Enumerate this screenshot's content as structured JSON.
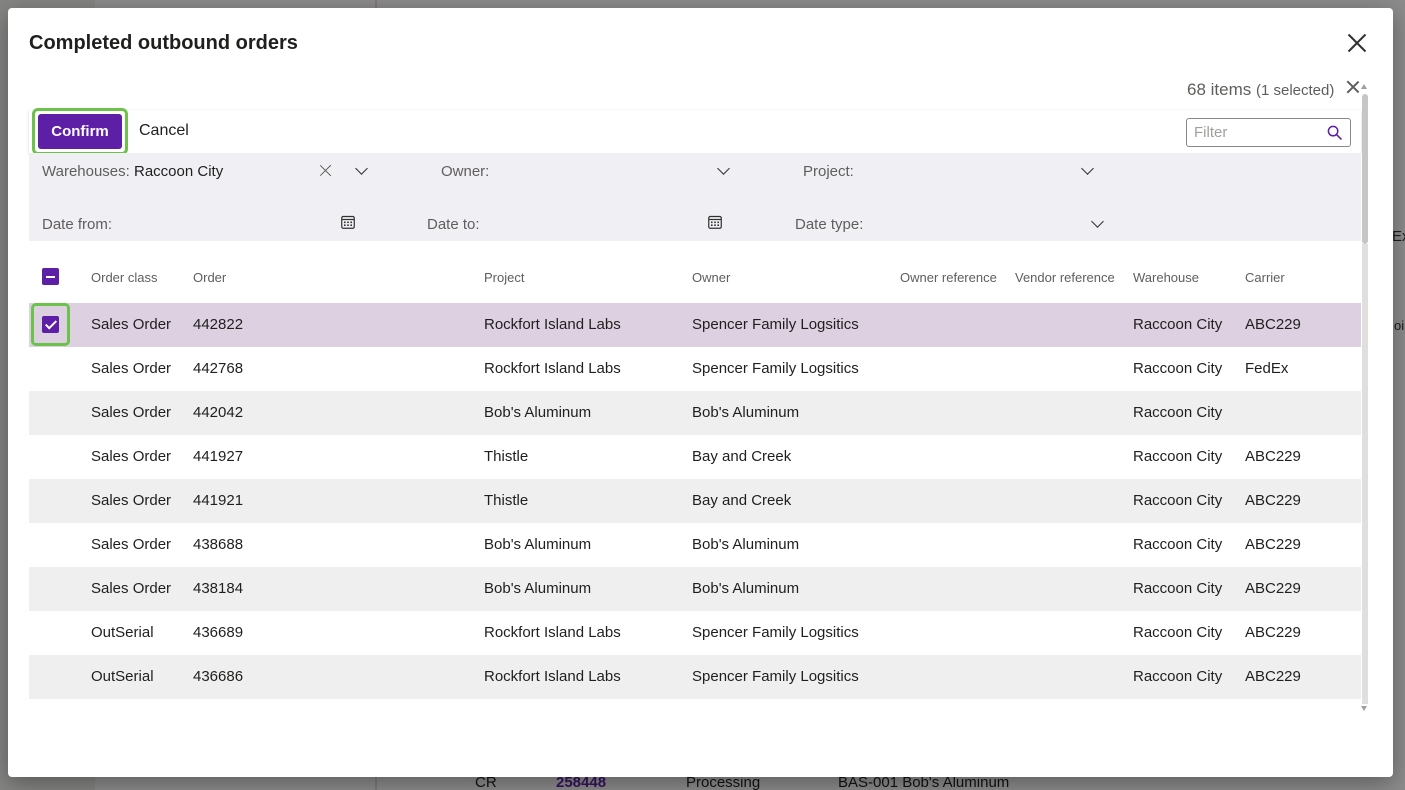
{
  "background": {
    "bottom_row": {
      "class": "CR",
      "order": "258448",
      "status": "Processing",
      "owner": "BAS-001 Bob's Aluminum"
    },
    "right_edge_top": "Ex",
    "right_edge_mid": "oi"
  },
  "dialog": {
    "title": "Completed outbound orders",
    "items_count": "68 items",
    "selected_count": "(1 selected)",
    "toolbar": {
      "confirm_label": "Confirm",
      "cancel_label": "Cancel",
      "filter_placeholder": "Filter"
    },
    "filters": {
      "warehouses_label": "Warehouses:",
      "warehouses_value": "Raccoon City",
      "owner_label": "Owner:",
      "project_label": "Project:",
      "date_from_label": "Date from:",
      "date_to_label": "Date to:",
      "date_type_label": "Date type:"
    },
    "columns": [
      "Order class",
      "Order",
      "Project",
      "Owner",
      "Owner reference",
      "Vendor reference",
      "Warehouse",
      "Carrier"
    ],
    "rows": [
      {
        "order_class": "Sales Order",
        "order": "442822",
        "project": "Rockfort Island Labs",
        "owner": "Spencer Family Logsitics",
        "owner_ref": "",
        "vendor_ref": "",
        "warehouse": "Raccoon City",
        "carrier": "ABC229",
        "selected": true
      },
      {
        "order_class": "Sales Order",
        "order": "442768",
        "project": "Rockfort Island Labs",
        "owner": "Spencer Family Logsitics",
        "owner_ref": "",
        "vendor_ref": "",
        "warehouse": "Raccoon City",
        "carrier": "FedEx",
        "selected": false
      },
      {
        "order_class": "Sales Order",
        "order": "442042",
        "project": "Bob's Aluminum",
        "owner": "Bob's Aluminum",
        "owner_ref": "",
        "vendor_ref": "",
        "warehouse": "Raccoon City",
        "carrier": "",
        "selected": false
      },
      {
        "order_class": "Sales Order",
        "order": "441927",
        "project": "Thistle",
        "owner": "Bay and Creek",
        "owner_ref": "",
        "vendor_ref": "",
        "warehouse": "Raccoon City",
        "carrier": "ABC229",
        "selected": false
      },
      {
        "order_class": "Sales Order",
        "order": "441921",
        "project": "Thistle",
        "owner": "Bay and Creek",
        "owner_ref": "",
        "vendor_ref": "",
        "warehouse": "Raccoon City",
        "carrier": "ABC229",
        "selected": false
      },
      {
        "order_class": "Sales Order",
        "order": "438688",
        "project": "Bob's Aluminum",
        "owner": "Bob's Aluminum",
        "owner_ref": "",
        "vendor_ref": "",
        "warehouse": "Raccoon City",
        "carrier": "ABC229",
        "selected": false
      },
      {
        "order_class": "Sales Order",
        "order": "438184",
        "project": "Bob's Aluminum",
        "owner": "Bob's Aluminum",
        "owner_ref": "",
        "vendor_ref": "",
        "warehouse": "Raccoon City",
        "carrier": "ABC229",
        "selected": false
      },
      {
        "order_class": "OutSerial",
        "order": "436689",
        "project": "Rockfort Island Labs",
        "owner": "Spencer Family Logsitics",
        "owner_ref": "",
        "vendor_ref": "",
        "warehouse": "Raccoon City",
        "carrier": "ABC229",
        "selected": false
      },
      {
        "order_class": "OutSerial",
        "order": "436686",
        "project": "Rockfort Island Labs",
        "owner": "Spencer Family Logsitics",
        "owner_ref": "",
        "vendor_ref": "",
        "warehouse": "Raccoon City",
        "carrier": "ABC229",
        "selected": false
      }
    ]
  },
  "colors": {
    "accent": "#5c1fa6",
    "highlight": "#6cc24a",
    "selected_row": "#dcd0e1"
  },
  "icons": {
    "close": "close-icon",
    "search": "search-icon",
    "calendar": "calendar-icon",
    "chevron": "chevron-down-icon"
  }
}
